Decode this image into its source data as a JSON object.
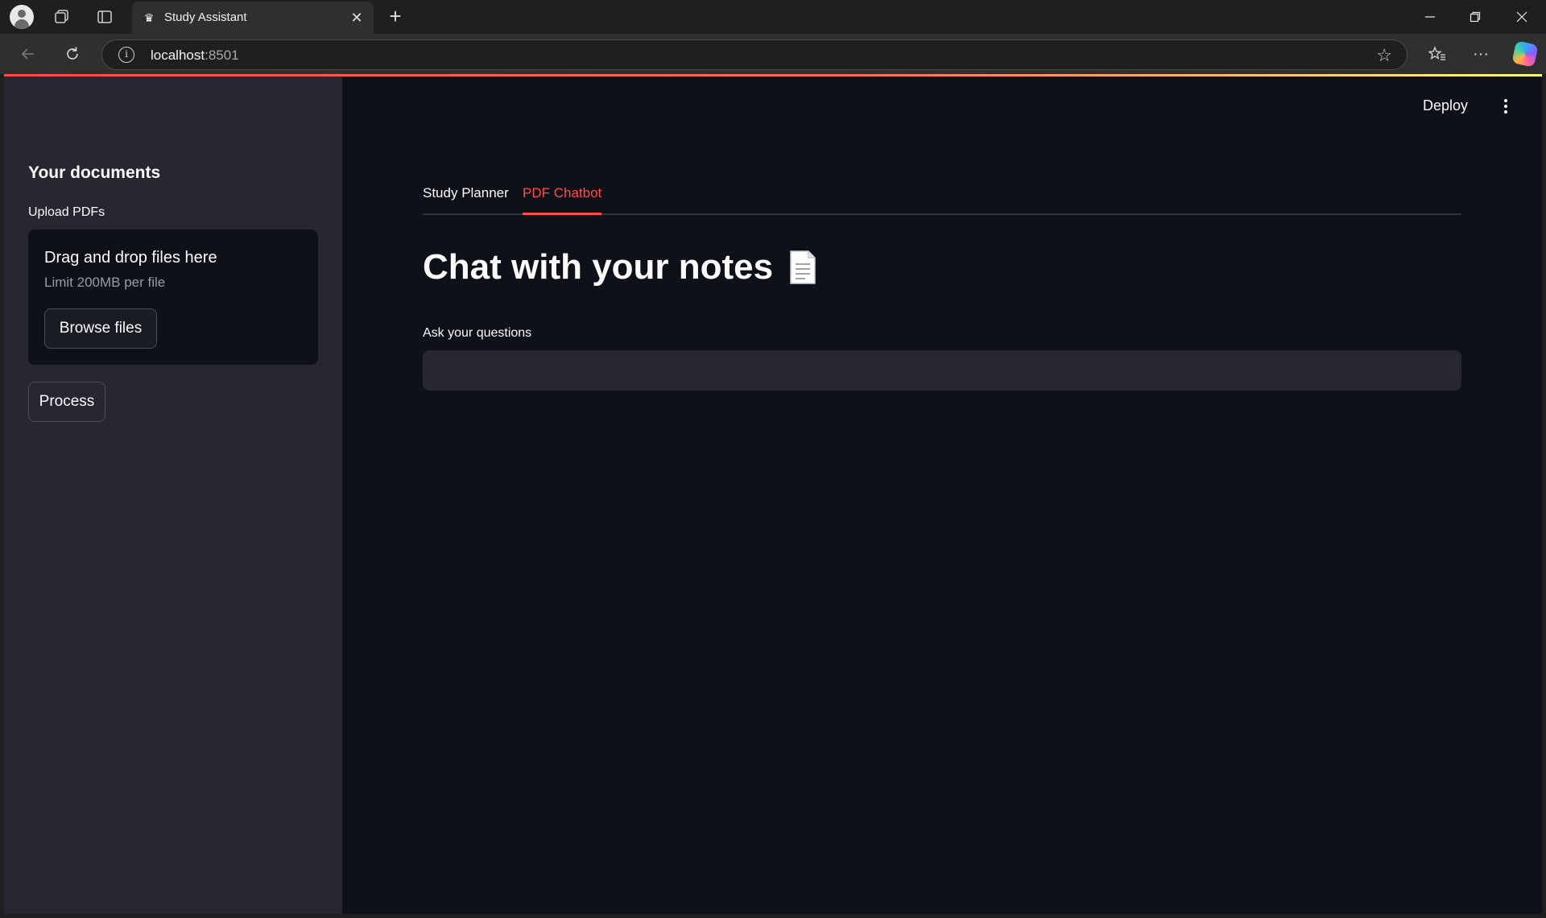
{
  "browser": {
    "tab_title": "Study Assistant",
    "url_host": "localhost",
    "url_port": ":8501"
  },
  "sidebar": {
    "heading": "Your documents",
    "upload_label": "Upload PDFs",
    "uploader": {
      "drag_text": "Drag and drop files here",
      "limit_text": "Limit 200MB per file",
      "browse_label": "Browse files"
    },
    "process_label": "Process"
  },
  "header": {
    "deploy_label": "Deploy"
  },
  "tabs": [
    {
      "label": "Study Planner",
      "active": false
    },
    {
      "label": "PDF Chatbot",
      "active": true
    }
  ],
  "main": {
    "title": "Chat with your notes",
    "title_icon": "page-facing-up-icon",
    "question_label": "Ask your questions",
    "question_value": "",
    "question_placeholder": ""
  },
  "colors": {
    "accent": "#ff4b4b",
    "background": "#0e1117",
    "sidebar": "#262730"
  }
}
